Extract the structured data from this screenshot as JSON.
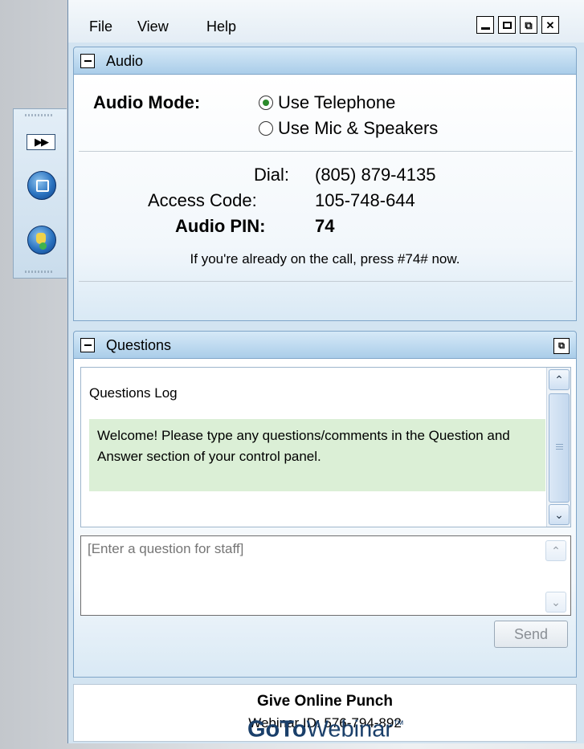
{
  "menu": {
    "file": "File",
    "view": "View",
    "help": "Help"
  },
  "audio": {
    "title": "Audio",
    "mode_label": "Audio Mode:",
    "options": [
      "Use Telephone",
      "Use Mic & Speakers"
    ],
    "selected": "Use Telephone",
    "dial_label": "Dial:",
    "dial_value": "(805) 879-4135",
    "access_label": "Access Code:",
    "access_value": "105-748-644",
    "pin_label": "Audio PIN:",
    "pin_value": "74",
    "note": "If you're already on the call, press #74# now."
  },
  "questions": {
    "title": "Questions",
    "log_title": "Questions Log",
    "welcome": "Welcome! Please type any questions/comments in the Question and Answer section of your control panel.",
    "input_placeholder": "[Enter a question for staff]",
    "send_label": "Send"
  },
  "webinar": {
    "title": "Give Online Punch",
    "id_text": "Webinar ID: 576-794-892"
  },
  "brand": {
    "go": "GoTo",
    "web": "Webinar",
    "tm": "™"
  },
  "icons": {
    "expand": "fast-forward-icon",
    "screen": "screen-icon",
    "hand": "raise-hand-icon"
  }
}
